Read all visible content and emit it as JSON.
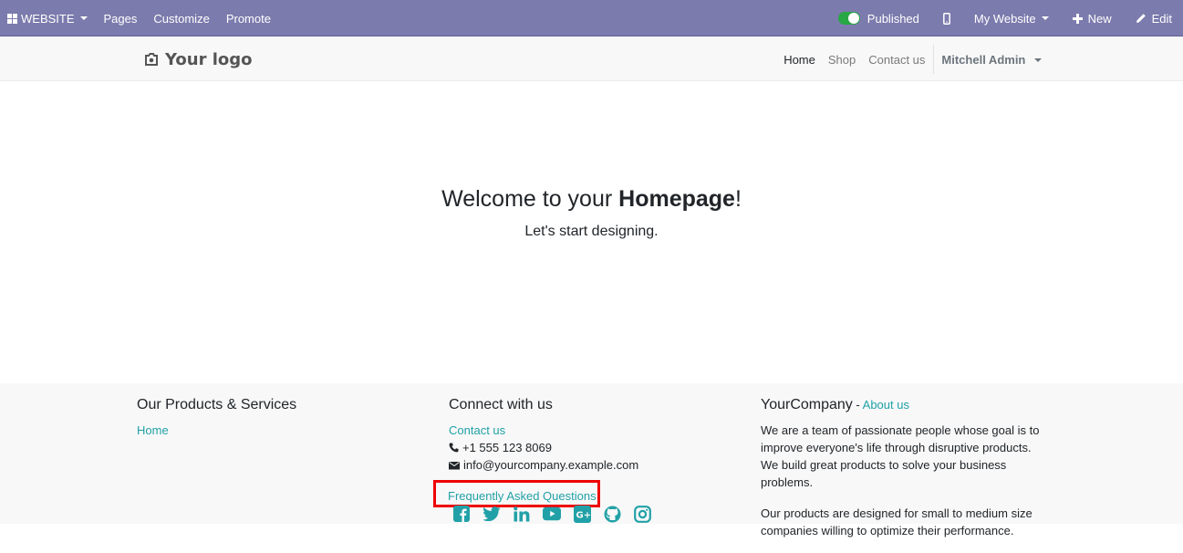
{
  "topbar": {
    "website_menu": "WEBSITE",
    "pages": "Pages",
    "customize": "Customize",
    "promote": "Promote",
    "published": "Published",
    "my_website": "My Website",
    "new": "New",
    "edit": "Edit"
  },
  "header": {
    "logo": "Your logo",
    "nav": [
      "Home",
      "Shop",
      "Contact us"
    ],
    "active_nav": "Home",
    "user": "Mitchell Admin"
  },
  "hero": {
    "title_prefix": "Welcome to your ",
    "title_bold": "Homepage",
    "title_suffix": "!",
    "subtitle": "Let's start designing."
  },
  "footer": {
    "products": {
      "heading": "Our Products & Services",
      "links": [
        "Home"
      ]
    },
    "connect": {
      "heading": "Connect with us",
      "contact": "Contact us",
      "phone": "+1 555 123 8069",
      "email": "info@yourcompany.example.com",
      "faq": "Frequently Asked Questions",
      "social_icons": [
        "facebook-icon",
        "twitter-icon",
        "linkedin-icon",
        "youtube-icon",
        "google-plus-icon",
        "github-icon",
        "instagram-icon"
      ]
    },
    "about": {
      "company": "YourCompany",
      "separator": " - ",
      "about_link": "About us",
      "paragraphs": [
        "We are a team of passionate people whose goal is to improve everyone's life through disruptive products. We build great products to solve your business problems.",
        "Our products are designed for small to medium size companies willing to optimize their performance."
      ]
    }
  },
  "colors": {
    "admin_bar": "#7c7bad",
    "link": "#21a1a7",
    "toggle_on": "#28a745",
    "highlight_box": "#e00000"
  }
}
